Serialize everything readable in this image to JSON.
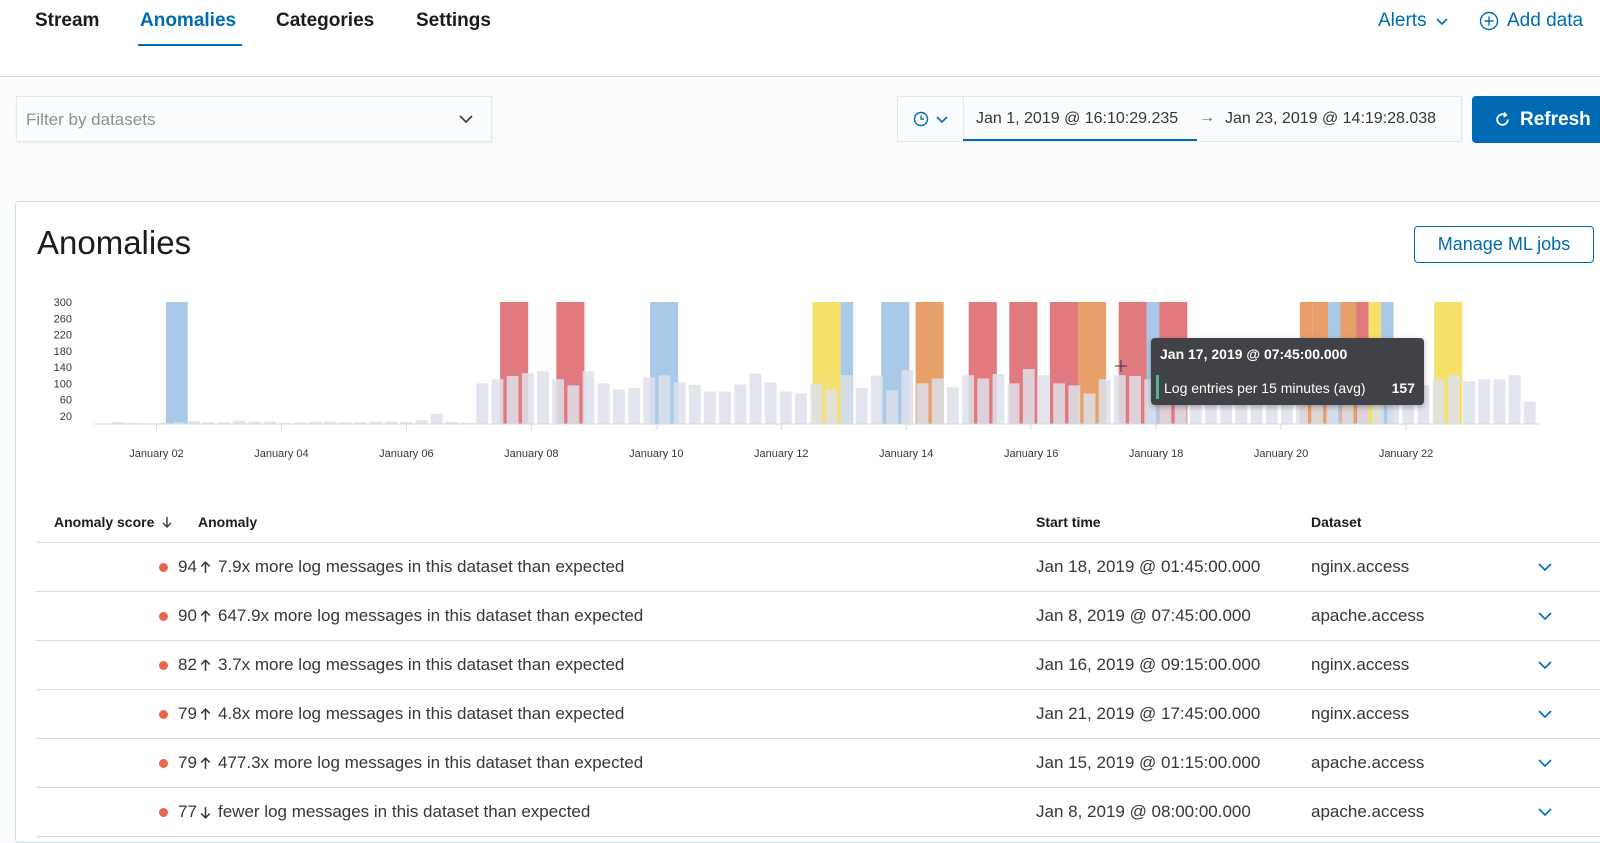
{
  "nav": {
    "tabs": [
      {
        "label": "Stream"
      },
      {
        "label": "Anomalies"
      },
      {
        "label": "Categories"
      },
      {
        "label": "Settings"
      }
    ],
    "alerts_label": "Alerts",
    "add_data_label": "Add data"
  },
  "filter": {
    "placeholder": "Filter by datasets"
  },
  "date_picker": {
    "start": "Jan 1, 2019 @ 16:10:29.235",
    "arrow": "→",
    "end": "Jan 23, 2019 @ 14:19:28.038",
    "refresh_label": "Refresh"
  },
  "panel": {
    "title": "Anomalies",
    "manage_ml_label": "Manage ML jobs"
  },
  "chart_data": {
    "type": "bar",
    "title": "",
    "xlabel": "",
    "ylabel": "Log entries per 15 minutes (avg)",
    "y_ticks": [
      "300",
      "260",
      "220",
      "180",
      "140",
      "100",
      "60",
      "20"
    ],
    "ylim": [
      0,
      300
    ],
    "x_ticks": [
      "January 02",
      "January 04",
      "January 06",
      "January 08",
      "January 10",
      "January 12",
      "January 14",
      "January 16",
      "January 18",
      "January 20",
      "January 22"
    ],
    "series": [
      {
        "values": [
          5,
          3,
          2,
          3,
          4,
          7,
          5,
          4,
          8,
          6,
          6,
          3,
          4,
          6,
          6,
          4,
          5,
          6,
          6,
          5,
          9,
          25,
          5,
          3,
          100,
          110,
          118,
          125,
          130,
          110,
          95,
          130,
          100,
          85,
          88,
          115,
          120,
          102,
          96,
          80,
          80,
          97,
          124,
          102,
          80,
          75,
          100,
          85,
          120,
          88,
          119,
          83,
          133,
          100,
          112,
          90,
          120,
          112,
          123,
          100,
          135,
          120,
          100,
          95,
          75,
          110,
          120,
          118,
          110,
          100,
          110,
          100,
          122,
          110,
          118,
          125,
          130,
          115,
          130,
          108,
          115,
          120,
          100,
          98,
          130,
          90,
          95,
          110,
          120,
          105,
          110,
          110,
          120,
          55
        ]
      }
    ],
    "anomaly_bands": [
      {
        "severity": "warning",
        "start_day": 1.15,
        "end_day": 1.5
      },
      {
        "severity": "critical",
        "start_day": 6.5,
        "end_day": 6.95
      },
      {
        "severity": "critical",
        "start_day": 7.4,
        "end_day": 7.85
      },
      {
        "severity": "warning",
        "start_day": 8.9,
        "end_day": 9.35
      },
      {
        "severity": "major",
        "start_day": 11.5,
        "end_day": 11.75
      },
      {
        "severity": "major",
        "start_day": 11.75,
        "end_day": 11.95
      },
      {
        "severity": "warning",
        "start_day": 11.95,
        "end_day": 12.15
      },
      {
        "severity": "warning",
        "start_day": 12.6,
        "end_day": 13.05
      },
      {
        "severity": "minor",
        "start_day": 13.15,
        "end_day": 13.6
      },
      {
        "severity": "critical",
        "start_day": 14.0,
        "end_day": 14.45
      },
      {
        "severity": "critical",
        "start_day": 14.65,
        "end_day": 15.1
      },
      {
        "severity": "critical",
        "start_day": 15.3,
        "end_day": 15.75
      },
      {
        "severity": "minor",
        "start_day": 15.75,
        "end_day": 16.2
      },
      {
        "severity": "critical",
        "start_day": 16.4,
        "end_day": 16.85
      },
      {
        "severity": "warning",
        "start_day": 16.85,
        "end_day": 17.05
      },
      {
        "severity": "critical",
        "start_day": 17.05,
        "end_day": 17.5
      },
      {
        "severity": "minor",
        "start_day": 19.3,
        "end_day": 19.5
      },
      {
        "severity": "minor",
        "start_day": 19.5,
        "end_day": 19.75
      },
      {
        "severity": "warning",
        "start_day": 19.75,
        "end_day": 19.95
      },
      {
        "severity": "minor",
        "start_day": 19.95,
        "end_day": 20.2
      },
      {
        "severity": "critical",
        "start_day": 20.2,
        "end_day": 20.4
      },
      {
        "severity": "major",
        "start_day": 20.4,
        "end_day": 20.6
      },
      {
        "severity": "warning",
        "start_day": 20.6,
        "end_day": 20.8
      },
      {
        "severity": "major",
        "start_day": 21.45,
        "end_day": 21.9
      }
    ],
    "severity_colors": {
      "critical": "#e07a7f",
      "minor": "#e7a06a",
      "major": "#f5e06a",
      "warning": "#a9c9e8"
    },
    "base_bar_color": "#dde1ea",
    "tooltip": {
      "title": "Jan 17, 2019 @ 07:45:00.000",
      "label": "Log entries per 15 minutes (avg)",
      "value": "157"
    }
  },
  "table": {
    "headers": {
      "score": "Anomaly score",
      "anomaly": "Anomaly",
      "start_time": "Start time",
      "dataset": "Dataset"
    },
    "rows": [
      {
        "score": "94",
        "direction": "up",
        "anomaly": "7.9x more log messages in this dataset than expected",
        "start_time": "Jan 18, 2019 @ 01:45:00.000",
        "dataset": "nginx.access"
      },
      {
        "score": "90",
        "direction": "up",
        "anomaly": "647.9x more log messages in this dataset than expected",
        "start_time": "Jan 8, 2019 @ 07:45:00.000",
        "dataset": "apache.access"
      },
      {
        "score": "82",
        "direction": "up",
        "anomaly": "3.7x more log messages in this dataset than expected",
        "start_time": "Jan 16, 2019 @ 09:15:00.000",
        "dataset": "nginx.access"
      },
      {
        "score": "79",
        "direction": "up",
        "anomaly": "4.8x more log messages in this dataset than expected",
        "start_time": "Jan 21, 2019 @ 17:45:00.000",
        "dataset": "nginx.access"
      },
      {
        "score": "79",
        "direction": "up",
        "anomaly": "477.3x more log messages in this dataset than expected",
        "start_time": "Jan 15, 2019 @ 01:15:00.000",
        "dataset": "apache.access"
      },
      {
        "score": "77",
        "direction": "down",
        "anomaly": "fewer log messages in this dataset than expected",
        "start_time": "Jan 8, 2019 @ 08:00:00.000",
        "dataset": "apache.access"
      }
    ]
  },
  "colors": {
    "accent": "#006bb4",
    "score_dot": "#e7664c"
  }
}
